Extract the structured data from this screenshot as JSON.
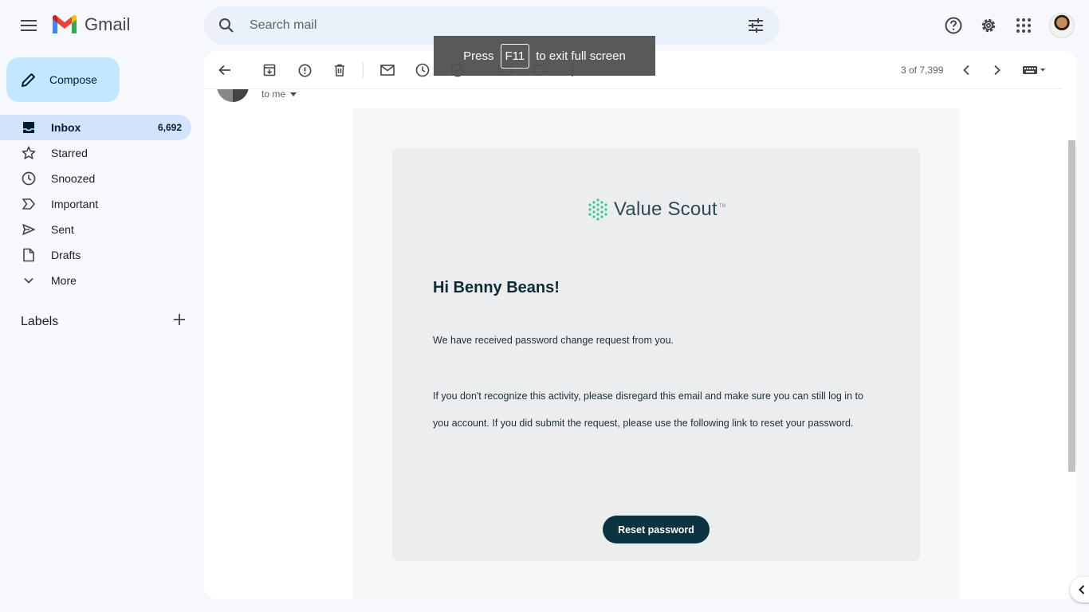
{
  "app": {
    "name": "Gmail"
  },
  "search": {
    "placeholder": "Search mail"
  },
  "compose": {
    "label": "Compose"
  },
  "sidebar": {
    "items": [
      {
        "label": "Inbox",
        "count": "6,692",
        "icon": "inbox-icon"
      },
      {
        "label": "Starred",
        "count": "",
        "icon": "star-icon"
      },
      {
        "label": "Snoozed",
        "count": "",
        "icon": "clock-icon"
      },
      {
        "label": "Important",
        "count": "",
        "icon": "important-icon"
      },
      {
        "label": "Sent",
        "count": "",
        "icon": "send-icon"
      },
      {
        "label": "Drafts",
        "count": "",
        "icon": "draft-icon"
      },
      {
        "label": "More",
        "count": "",
        "icon": "chevron-down-icon"
      }
    ],
    "labels_title": "Labels"
  },
  "toolbar": {
    "pager": "3 of 7,399"
  },
  "message": {
    "to_me": "to me"
  },
  "email": {
    "brand_name": "Value Scout",
    "brand_tm": "TM",
    "greeting": "Hi Benny Beans!",
    "para1": "We have received password change request from you.",
    "para2": "If you don't recognize this activity, please disregard this email and make sure you can still log in to you account. If you did submit the request, please use the following link to reset your password.",
    "button": "Reset password"
  },
  "fullscreen_toast": {
    "before": "Press",
    "key": "F11",
    "after": "to exit full screen"
  },
  "colors": {
    "accent": "#c2e7ff",
    "active_nav": "#d3e3fd",
    "button": "#0b3340",
    "brand_green": "#2ecc8a"
  }
}
